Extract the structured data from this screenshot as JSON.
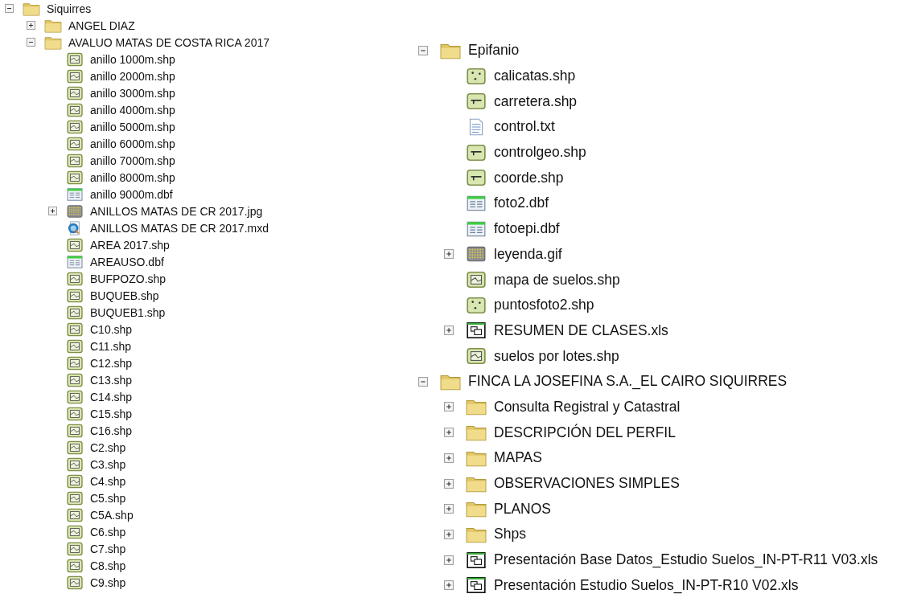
{
  "left_tree": {
    "items": [
      {
        "label": "Siquirres",
        "kind": "folder",
        "expanded": true,
        "children": [
          {
            "label": "ANGEL DIAZ",
            "kind": "folder",
            "expanded": false
          },
          {
            "label": "AVALUO MATAS DE COSTA RICA 2017",
            "kind": "folder",
            "expanded": true,
            "children": [
              {
                "label": "anillo 1000m.shp",
                "kind": "polygon"
              },
              {
                "label": "anillo 2000m.shp",
                "kind": "polygon"
              },
              {
                "label": "anillo 3000m.shp",
                "kind": "polygon"
              },
              {
                "label": "anillo 4000m.shp",
                "kind": "polygon"
              },
              {
                "label": "anillo 5000m.shp",
                "kind": "polygon"
              },
              {
                "label": "anillo 6000m.shp",
                "kind": "polygon"
              },
              {
                "label": "anillo 7000m.shp",
                "kind": "polygon"
              },
              {
                "label": "anillo 8000m.shp",
                "kind": "polygon"
              },
              {
                "label": "anillo 9000m.dbf",
                "kind": "table"
              },
              {
                "label": "ANILLOS MATAS DE CR 2017.jpg",
                "kind": "raster",
                "expanded": false
              },
              {
                "label": "ANILLOS MATAS DE CR 2017.mxd",
                "kind": "mapdoc"
              },
              {
                "label": "AREA 2017.shp",
                "kind": "polygon"
              },
              {
                "label": "AREAUSO.dbf",
                "kind": "table"
              },
              {
                "label": "BUFPOZO.shp",
                "kind": "polygon"
              },
              {
                "label": "BUQUEB.shp",
                "kind": "polygon"
              },
              {
                "label": "BUQUEB1.shp",
                "kind": "polygon"
              },
              {
                "label": "C10.shp",
                "kind": "polygon"
              },
              {
                "label": "C11.shp",
                "kind": "polygon"
              },
              {
                "label": "C12.shp",
                "kind": "polygon"
              },
              {
                "label": "C13.shp",
                "kind": "polygon"
              },
              {
                "label": "C14.shp",
                "kind": "polygon"
              },
              {
                "label": "C15.shp",
                "kind": "polygon"
              },
              {
                "label": "C16.shp",
                "kind": "polygon"
              },
              {
                "label": "C2.shp",
                "kind": "polygon"
              },
              {
                "label": "C3.shp",
                "kind": "polygon"
              },
              {
                "label": "C4.shp",
                "kind": "polygon"
              },
              {
                "label": "C5.shp",
                "kind": "polygon"
              },
              {
                "label": "C5A.shp",
                "kind": "polygon"
              },
              {
                "label": "C6.shp",
                "kind": "polygon"
              },
              {
                "label": "C7.shp",
                "kind": "polygon"
              },
              {
                "label": "C8.shp",
                "kind": "polygon"
              },
              {
                "label": "C9.shp",
                "kind": "polygon"
              }
            ]
          }
        ]
      }
    ]
  },
  "right_tree": {
    "items": [
      {
        "label": "Epifanio",
        "kind": "folder",
        "expanded": true,
        "children": [
          {
            "label": "calicatas.shp",
            "kind": "point"
          },
          {
            "label": "carretera.shp",
            "kind": "line"
          },
          {
            "label": "control.txt",
            "kind": "text"
          },
          {
            "label": "controlgeo.shp",
            "kind": "line"
          },
          {
            "label": "coorde.shp",
            "kind": "line"
          },
          {
            "label": "foto2.dbf",
            "kind": "table"
          },
          {
            "label": "fotoepi.dbf",
            "kind": "table"
          },
          {
            "label": "leyenda.gif",
            "kind": "raster",
            "expanded": false
          },
          {
            "label": "mapa de suelos.shp",
            "kind": "polygon"
          },
          {
            "label": "puntosfoto2.shp",
            "kind": "point"
          },
          {
            "label": "RESUMEN DE CLASES.xls",
            "kind": "sheet",
            "expanded": false
          },
          {
            "label": "suelos por lotes.shp",
            "kind": "polygon"
          }
        ]
      },
      {
        "label": "FINCA LA JOSEFINA S.A._EL CAIRO SIQUIRRES",
        "kind": "folder",
        "expanded": true,
        "children": [
          {
            "label": "Consulta Registral y Catastral",
            "kind": "folder",
            "expanded": false
          },
          {
            "label": "DESCRIPCIÓN DEL PERFIL",
            "kind": "folder",
            "expanded": false
          },
          {
            "label": "MAPAS",
            "kind": "folder",
            "expanded": false
          },
          {
            "label": "OBSERVACIONES SIMPLES",
            "kind": "folder",
            "expanded": false
          },
          {
            "label": "PLANOS",
            "kind": "folder",
            "expanded": false
          },
          {
            "label": "Shps",
            "kind": "folder",
            "expanded": false
          },
          {
            "label": "Presentación Base Datos_Estudio Suelos_IN-PT-R11 V03.xls",
            "kind": "sheet",
            "expanded": false
          },
          {
            "label": "Presentación Estudio Suelos_IN-PT-R10 V02.xls",
            "kind": "sheet",
            "expanded": false
          }
        ]
      }
    ]
  }
}
